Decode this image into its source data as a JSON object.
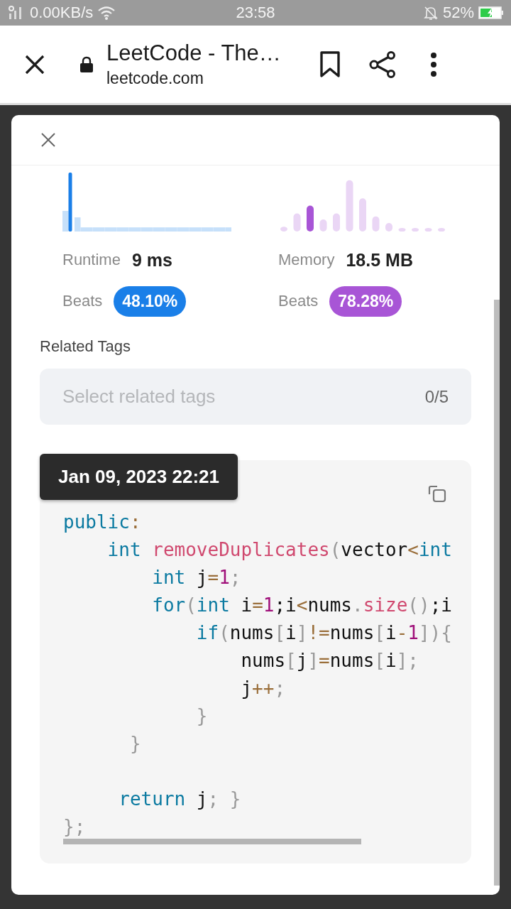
{
  "status_bar": {
    "network_speed": "0.00KB/s",
    "time": "23:58",
    "battery": "52%"
  },
  "browser_bar": {
    "title": "LeetCode - The…",
    "url": "leetcode.com"
  },
  "stats": [
    {
      "label": "Runtime",
      "value": "9 ms",
      "beats_label": "Beats",
      "beats": "48.10%",
      "color": "#1a7fe8"
    },
    {
      "label": "Memory",
      "value": "18.5 MB",
      "beats_label": "Beats",
      "beats": "78.28%",
      "color": "#a855d6"
    }
  ],
  "related_tags": {
    "title": "Related Tags",
    "placeholder": "Select related tags",
    "count": "0/5"
  },
  "tooltip": "Jan 09, 2023 22:21",
  "code": [
    {
      "tokens": [
        {
          "kind": "keyword",
          "text": "public"
        },
        {
          "kind": "op",
          "text": ":"
        }
      ]
    },
    {
      "tokens": [
        {
          "kind": "keyword",
          "text": "    int"
        },
        {
          "kind": "func",
          "text": " removeDuplicates"
        },
        {
          "kind": "punct",
          "text": "("
        },
        {
          "kind": "plain",
          "text": "vector"
        },
        {
          "kind": "op",
          "text": "<"
        },
        {
          "kind": "keyword",
          "text": "int"
        }
      ]
    },
    {
      "tokens": [
        {
          "kind": "keyword",
          "text": "        int"
        },
        {
          "kind": "plain",
          "text": " j"
        },
        {
          "kind": "op",
          "text": "="
        },
        {
          "kind": "num",
          "text": "1"
        },
        {
          "kind": "punct",
          "text": ";"
        }
      ]
    },
    {
      "tokens": [
        {
          "kind": "keyword",
          "text": "        for"
        },
        {
          "kind": "punct",
          "text": "("
        },
        {
          "kind": "keyword",
          "text": "int"
        },
        {
          "kind": "plain",
          "text": " i"
        },
        {
          "kind": "op",
          "text": "="
        },
        {
          "kind": "num",
          "text": "1"
        },
        {
          "kind": "plain",
          "text": ";i"
        },
        {
          "kind": "op",
          "text": "<"
        },
        {
          "kind": "plain",
          "text": "nums"
        },
        {
          "kind": "punct",
          "text": "."
        },
        {
          "kind": "func",
          "text": "size"
        },
        {
          "kind": "punct",
          "text": "()"
        },
        {
          "kind": "plain",
          "text": ";i"
        }
      ]
    },
    {
      "tokens": [
        {
          "kind": "keyword",
          "text": "            if"
        },
        {
          "kind": "punct",
          "text": "("
        },
        {
          "kind": "plain",
          "text": "nums"
        },
        {
          "kind": "punct",
          "text": "["
        },
        {
          "kind": "plain",
          "text": "i"
        },
        {
          "kind": "punct",
          "text": "]"
        },
        {
          "kind": "op",
          "text": "!="
        },
        {
          "kind": "plain",
          "text": "nums"
        },
        {
          "kind": "punct",
          "text": "["
        },
        {
          "kind": "plain",
          "text": "i"
        },
        {
          "kind": "op",
          "text": "-"
        },
        {
          "kind": "num",
          "text": "1"
        },
        {
          "kind": "punct",
          "text": "]){"
        }
      ]
    },
    {
      "tokens": [
        {
          "kind": "plain",
          "text": "                nums"
        },
        {
          "kind": "punct",
          "text": "["
        },
        {
          "kind": "plain",
          "text": "j"
        },
        {
          "kind": "punct",
          "text": "]"
        },
        {
          "kind": "op",
          "text": "="
        },
        {
          "kind": "plain",
          "text": "nums"
        },
        {
          "kind": "punct",
          "text": "["
        },
        {
          "kind": "plain",
          "text": "i"
        },
        {
          "kind": "punct",
          "text": "];"
        }
      ]
    },
    {
      "tokens": [
        {
          "kind": "plain",
          "text": "                j"
        },
        {
          "kind": "op",
          "text": "++"
        },
        {
          "kind": "punct",
          "text": ";"
        }
      ]
    },
    {
      "tokens": [
        {
          "kind": "punct",
          "text": "            }"
        }
      ]
    },
    {
      "tokens": [
        {
          "kind": "punct",
          "text": "      }"
        }
      ]
    },
    {
      "blank_before": true,
      "tokens": [
        {
          "kind": "keyword",
          "text": "     return"
        },
        {
          "kind": "plain",
          "text": " j"
        },
        {
          "kind": "punct",
          "text": "; }"
        }
      ]
    },
    {
      "tokens": [
        {
          "kind": "punct",
          "text": "};"
        }
      ]
    }
  ]
}
